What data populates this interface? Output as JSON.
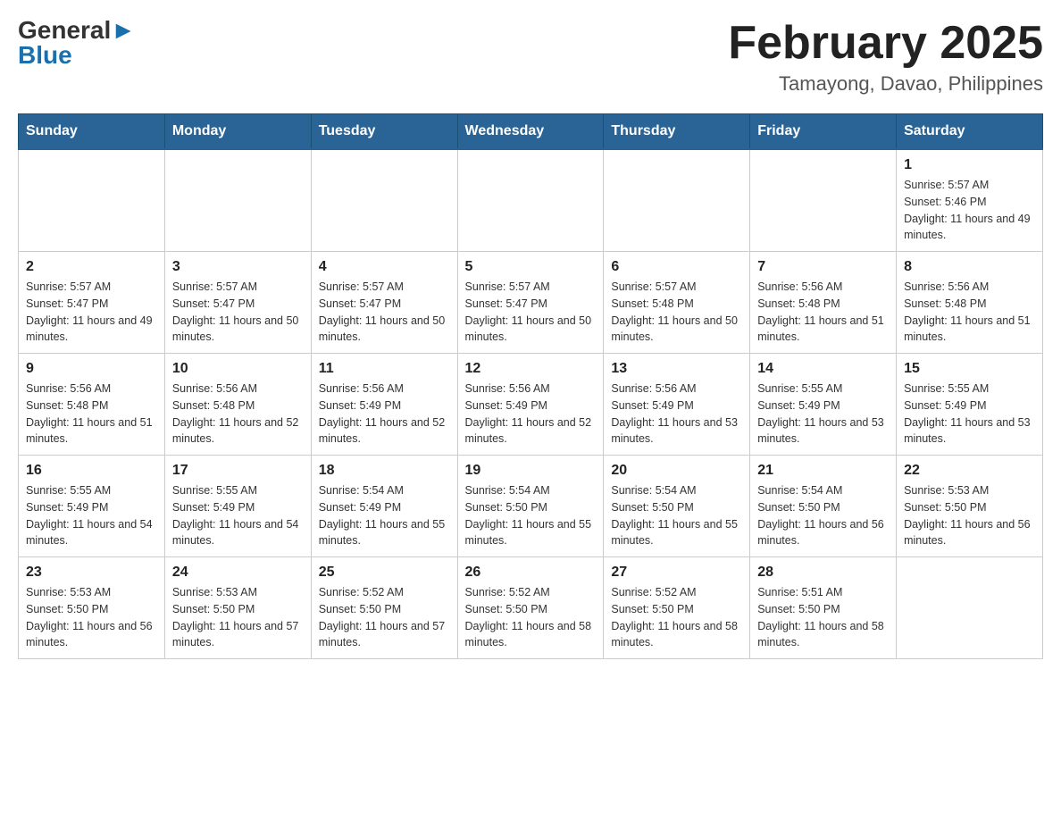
{
  "header": {
    "logo_general": "General",
    "logo_blue": "Blue",
    "month_title": "February 2025",
    "location": "Tamayong, Davao, Philippines"
  },
  "weekdays": [
    "Sunday",
    "Monday",
    "Tuesday",
    "Wednesday",
    "Thursday",
    "Friday",
    "Saturday"
  ],
  "weeks": [
    [
      {
        "day": "",
        "sunrise": "",
        "sunset": "",
        "daylight": ""
      },
      {
        "day": "",
        "sunrise": "",
        "sunset": "",
        "daylight": ""
      },
      {
        "day": "",
        "sunrise": "",
        "sunset": "",
        "daylight": ""
      },
      {
        "day": "",
        "sunrise": "",
        "sunset": "",
        "daylight": ""
      },
      {
        "day": "",
        "sunrise": "",
        "sunset": "",
        "daylight": ""
      },
      {
        "day": "",
        "sunrise": "",
        "sunset": "",
        "daylight": ""
      },
      {
        "day": "1",
        "sunrise": "Sunrise: 5:57 AM",
        "sunset": "Sunset: 5:46 PM",
        "daylight": "Daylight: 11 hours and 49 minutes."
      }
    ],
    [
      {
        "day": "2",
        "sunrise": "Sunrise: 5:57 AM",
        "sunset": "Sunset: 5:47 PM",
        "daylight": "Daylight: 11 hours and 49 minutes."
      },
      {
        "day": "3",
        "sunrise": "Sunrise: 5:57 AM",
        "sunset": "Sunset: 5:47 PM",
        "daylight": "Daylight: 11 hours and 50 minutes."
      },
      {
        "day": "4",
        "sunrise": "Sunrise: 5:57 AM",
        "sunset": "Sunset: 5:47 PM",
        "daylight": "Daylight: 11 hours and 50 minutes."
      },
      {
        "day": "5",
        "sunrise": "Sunrise: 5:57 AM",
        "sunset": "Sunset: 5:47 PM",
        "daylight": "Daylight: 11 hours and 50 minutes."
      },
      {
        "day": "6",
        "sunrise": "Sunrise: 5:57 AM",
        "sunset": "Sunset: 5:48 PM",
        "daylight": "Daylight: 11 hours and 50 minutes."
      },
      {
        "day": "7",
        "sunrise": "Sunrise: 5:56 AM",
        "sunset": "Sunset: 5:48 PM",
        "daylight": "Daylight: 11 hours and 51 minutes."
      },
      {
        "day": "8",
        "sunrise": "Sunrise: 5:56 AM",
        "sunset": "Sunset: 5:48 PM",
        "daylight": "Daylight: 11 hours and 51 minutes."
      }
    ],
    [
      {
        "day": "9",
        "sunrise": "Sunrise: 5:56 AM",
        "sunset": "Sunset: 5:48 PM",
        "daylight": "Daylight: 11 hours and 51 minutes."
      },
      {
        "day": "10",
        "sunrise": "Sunrise: 5:56 AM",
        "sunset": "Sunset: 5:48 PM",
        "daylight": "Daylight: 11 hours and 52 minutes."
      },
      {
        "day": "11",
        "sunrise": "Sunrise: 5:56 AM",
        "sunset": "Sunset: 5:49 PM",
        "daylight": "Daylight: 11 hours and 52 minutes."
      },
      {
        "day": "12",
        "sunrise": "Sunrise: 5:56 AM",
        "sunset": "Sunset: 5:49 PM",
        "daylight": "Daylight: 11 hours and 52 minutes."
      },
      {
        "day": "13",
        "sunrise": "Sunrise: 5:56 AM",
        "sunset": "Sunset: 5:49 PM",
        "daylight": "Daylight: 11 hours and 53 minutes."
      },
      {
        "day": "14",
        "sunrise": "Sunrise: 5:55 AM",
        "sunset": "Sunset: 5:49 PM",
        "daylight": "Daylight: 11 hours and 53 minutes."
      },
      {
        "day": "15",
        "sunrise": "Sunrise: 5:55 AM",
        "sunset": "Sunset: 5:49 PM",
        "daylight": "Daylight: 11 hours and 53 minutes."
      }
    ],
    [
      {
        "day": "16",
        "sunrise": "Sunrise: 5:55 AM",
        "sunset": "Sunset: 5:49 PM",
        "daylight": "Daylight: 11 hours and 54 minutes."
      },
      {
        "day": "17",
        "sunrise": "Sunrise: 5:55 AM",
        "sunset": "Sunset: 5:49 PM",
        "daylight": "Daylight: 11 hours and 54 minutes."
      },
      {
        "day": "18",
        "sunrise": "Sunrise: 5:54 AM",
        "sunset": "Sunset: 5:49 PM",
        "daylight": "Daylight: 11 hours and 55 minutes."
      },
      {
        "day": "19",
        "sunrise": "Sunrise: 5:54 AM",
        "sunset": "Sunset: 5:50 PM",
        "daylight": "Daylight: 11 hours and 55 minutes."
      },
      {
        "day": "20",
        "sunrise": "Sunrise: 5:54 AM",
        "sunset": "Sunset: 5:50 PM",
        "daylight": "Daylight: 11 hours and 55 minutes."
      },
      {
        "day": "21",
        "sunrise": "Sunrise: 5:54 AM",
        "sunset": "Sunset: 5:50 PM",
        "daylight": "Daylight: 11 hours and 56 minutes."
      },
      {
        "day": "22",
        "sunrise": "Sunrise: 5:53 AM",
        "sunset": "Sunset: 5:50 PM",
        "daylight": "Daylight: 11 hours and 56 minutes."
      }
    ],
    [
      {
        "day": "23",
        "sunrise": "Sunrise: 5:53 AM",
        "sunset": "Sunset: 5:50 PM",
        "daylight": "Daylight: 11 hours and 56 minutes."
      },
      {
        "day": "24",
        "sunrise": "Sunrise: 5:53 AM",
        "sunset": "Sunset: 5:50 PM",
        "daylight": "Daylight: 11 hours and 57 minutes."
      },
      {
        "day": "25",
        "sunrise": "Sunrise: 5:52 AM",
        "sunset": "Sunset: 5:50 PM",
        "daylight": "Daylight: 11 hours and 57 minutes."
      },
      {
        "day": "26",
        "sunrise": "Sunrise: 5:52 AM",
        "sunset": "Sunset: 5:50 PM",
        "daylight": "Daylight: 11 hours and 58 minutes."
      },
      {
        "day": "27",
        "sunrise": "Sunrise: 5:52 AM",
        "sunset": "Sunset: 5:50 PM",
        "daylight": "Daylight: 11 hours and 58 minutes."
      },
      {
        "day": "28",
        "sunrise": "Sunrise: 5:51 AM",
        "sunset": "Sunset: 5:50 PM",
        "daylight": "Daylight: 11 hours and 58 minutes."
      },
      {
        "day": "",
        "sunrise": "",
        "sunset": "",
        "daylight": ""
      }
    ]
  ]
}
